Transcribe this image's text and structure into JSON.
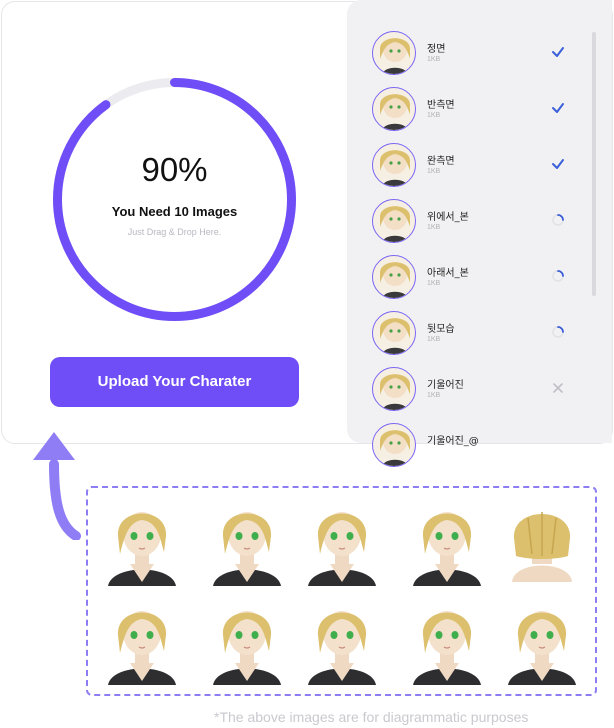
{
  "progress": {
    "percent_label": "90%",
    "fraction": 0.9,
    "headline": "You Need 10 Images",
    "hint": "Just Drag & Drop Here."
  },
  "upload_button": {
    "label": "Upload Your Charater"
  },
  "file_list": [
    {
      "name": "정면",
      "size": "1KB",
      "status": "done"
    },
    {
      "name": "반측면",
      "size": "1KB",
      "status": "done"
    },
    {
      "name": "완측면",
      "size": "1KB",
      "status": "done"
    },
    {
      "name": "위에서_본",
      "size": "1KB",
      "status": "loading"
    },
    {
      "name": "아래서_본",
      "size": "1KB",
      "status": "loading"
    },
    {
      "name": "뒷모습",
      "size": "1KB",
      "status": "loading"
    },
    {
      "name": "기울어진",
      "size": "1KB",
      "status": "error"
    },
    {
      "name": "기울어진_@",
      "size": "",
      "status": ""
    }
  ],
  "footnote": "*The above images are for diagrammatic purposes",
  "colors": {
    "accent": "#6f4ef7",
    "ring_track": "#ececf0",
    "check": "#3a5fd9",
    "dashed_border": "#8c7df3",
    "arrow": "#8f7df6"
  },
  "icons": {
    "done": "check-icon",
    "loading": "spinner-icon",
    "error": "close-icon",
    "arrow": "curved-arrow-up-icon"
  }
}
